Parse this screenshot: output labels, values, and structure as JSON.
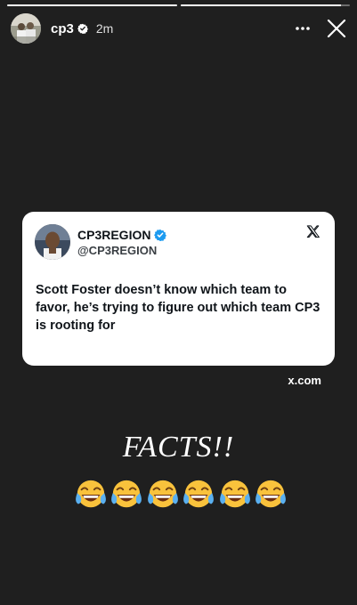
{
  "progress": {
    "segments": [
      {
        "fill": 1.0
      },
      {
        "fill": 0.95
      }
    ]
  },
  "header": {
    "username": "cp3",
    "time": "2m",
    "avatar_icon": "user-avatar",
    "more_icon": "more-horizontal-icon",
    "close_icon": "close-icon"
  },
  "tweet": {
    "name": "CP3REGION",
    "handle": "@CP3REGION",
    "text": "Scott Foster doesn’t know which team to favor, he’s trying to figure out which team CP3 is rooting for",
    "logo_icon": "x-logo-icon"
  },
  "link": {
    "domain": "x.com"
  },
  "caption": {
    "text": "FACTS!!"
  },
  "emojis": {
    "count": 6,
    "type": "face-with-tears-of-joy"
  },
  "colors": {
    "background": "#1f1f1f",
    "card": "#ffffff",
    "verified": "#1d9bf0",
    "emoji_face": "#f9c23c"
  }
}
